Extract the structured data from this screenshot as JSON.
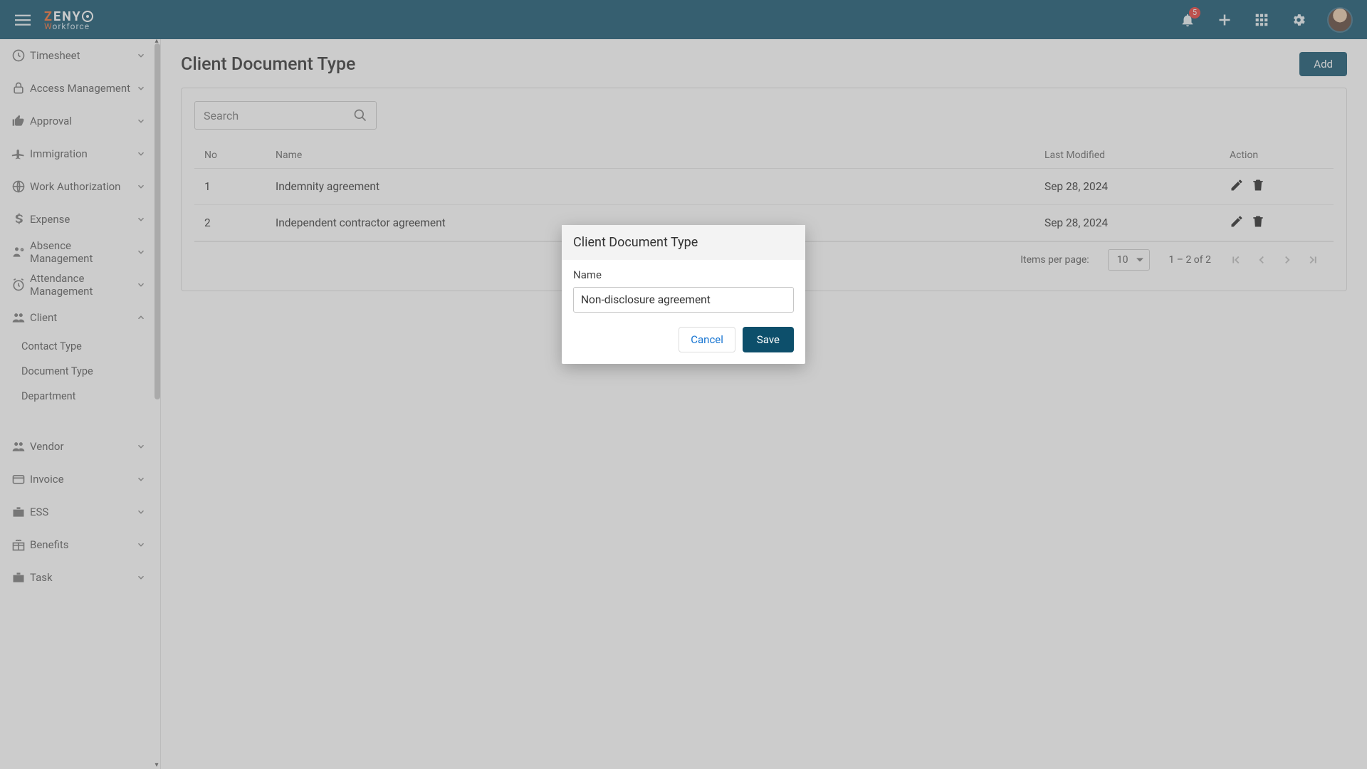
{
  "brand": {
    "z": "Z",
    "rest": "ENY",
    "sub_w": "W",
    "sub_rest": "orkforce"
  },
  "notif_count": "5",
  "page": {
    "title": "Client Document Type",
    "add": "Add"
  },
  "search": {
    "placeholder": "Search"
  },
  "table": {
    "headers": {
      "no": "No",
      "name": "Name",
      "modified": "Last Modified",
      "action": "Action"
    },
    "rows": [
      {
        "no": "1",
        "name": "Indemnity agreement",
        "modified": "Sep 28, 2024"
      },
      {
        "no": "2",
        "name": "Independent contractor agreement",
        "modified": "Sep 28, 2024"
      }
    ]
  },
  "paginator": {
    "ipp_label": "Items per page:",
    "ipp_value": "10",
    "range": "1 – 2 of 2"
  },
  "sidebar": {
    "items": [
      {
        "label": "Timesheet"
      },
      {
        "label": "Access Management"
      },
      {
        "label": "Approval"
      },
      {
        "label": "Immigration"
      },
      {
        "label": "Work Authorization"
      },
      {
        "label": "Expense"
      },
      {
        "label": "Absence Management"
      },
      {
        "label": "Attendance Management"
      },
      {
        "label": "Client"
      },
      {
        "label": "Vendor"
      },
      {
        "label": "Invoice"
      },
      {
        "label": "ESS"
      },
      {
        "label": "Benefits"
      },
      {
        "label": "Task"
      }
    ],
    "client_subs": [
      {
        "label": "Contact Type"
      },
      {
        "label": "Document Type"
      },
      {
        "label": "Department"
      }
    ]
  },
  "dialog": {
    "title": "Client Document Type",
    "name_label": "Name",
    "name_value": "Non-disclosure agreement",
    "cancel": "Cancel",
    "save": "Save"
  }
}
